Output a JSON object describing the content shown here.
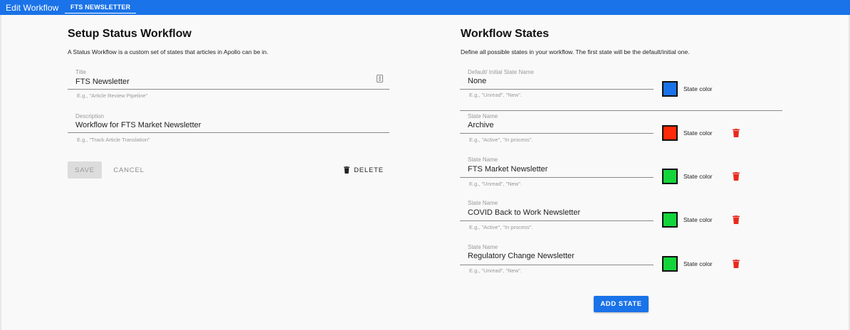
{
  "header": {
    "title": "Edit Workflow",
    "tab_label": "FTS NEWSLETTER"
  },
  "setup": {
    "heading": "Setup Status Workflow",
    "description": "A Status Workflow is a custom set of states that articles in Apollo can be in.",
    "title_field": {
      "label": "Title",
      "value": "FTS Newsletter",
      "hint": "E.g., \"Article Review Pipeline\""
    },
    "description_field": {
      "label": "Description",
      "value": "Workflow for FTS Market Newsletter",
      "hint": "E.g., \"Track Article Translation\""
    },
    "save_label": "SAVE",
    "cancel_label": "CANCEL",
    "delete_label": "DELETE"
  },
  "states": {
    "heading": "Workflow States",
    "description": "Define all possible states in your workflow. The first state will be the default/initial one.",
    "color_label": "State color",
    "add_label": "ADD STATE",
    "items": [
      {
        "label": "Default/ Initial State Name",
        "value": "None",
        "hint": "E.g., \"Unread\", \"New\".",
        "color": "#1a73e8"
      },
      {
        "label": "State Name",
        "value": "Archive",
        "hint": "E.g., \"Active\", \"In process\".",
        "color": "#ff2a0a"
      },
      {
        "label": "State Name",
        "value": "FTS Market Newsletter",
        "hint": "E.g., \"Unread\", \"New\".",
        "color": "#14d43c"
      },
      {
        "label": "State Name",
        "value": "COVID Back to Work Newsletter",
        "hint": "E.g., \"Active\", \"In process\".",
        "color": "#14d43c"
      },
      {
        "label": "State Name",
        "value": "Regulatory Change Newsletter",
        "hint": "E.g., \"Unread\", \"New\".",
        "color": "#14d43c"
      }
    ]
  },
  "colors": {
    "primary": "#1a73e8",
    "danger": "#e8291c"
  }
}
